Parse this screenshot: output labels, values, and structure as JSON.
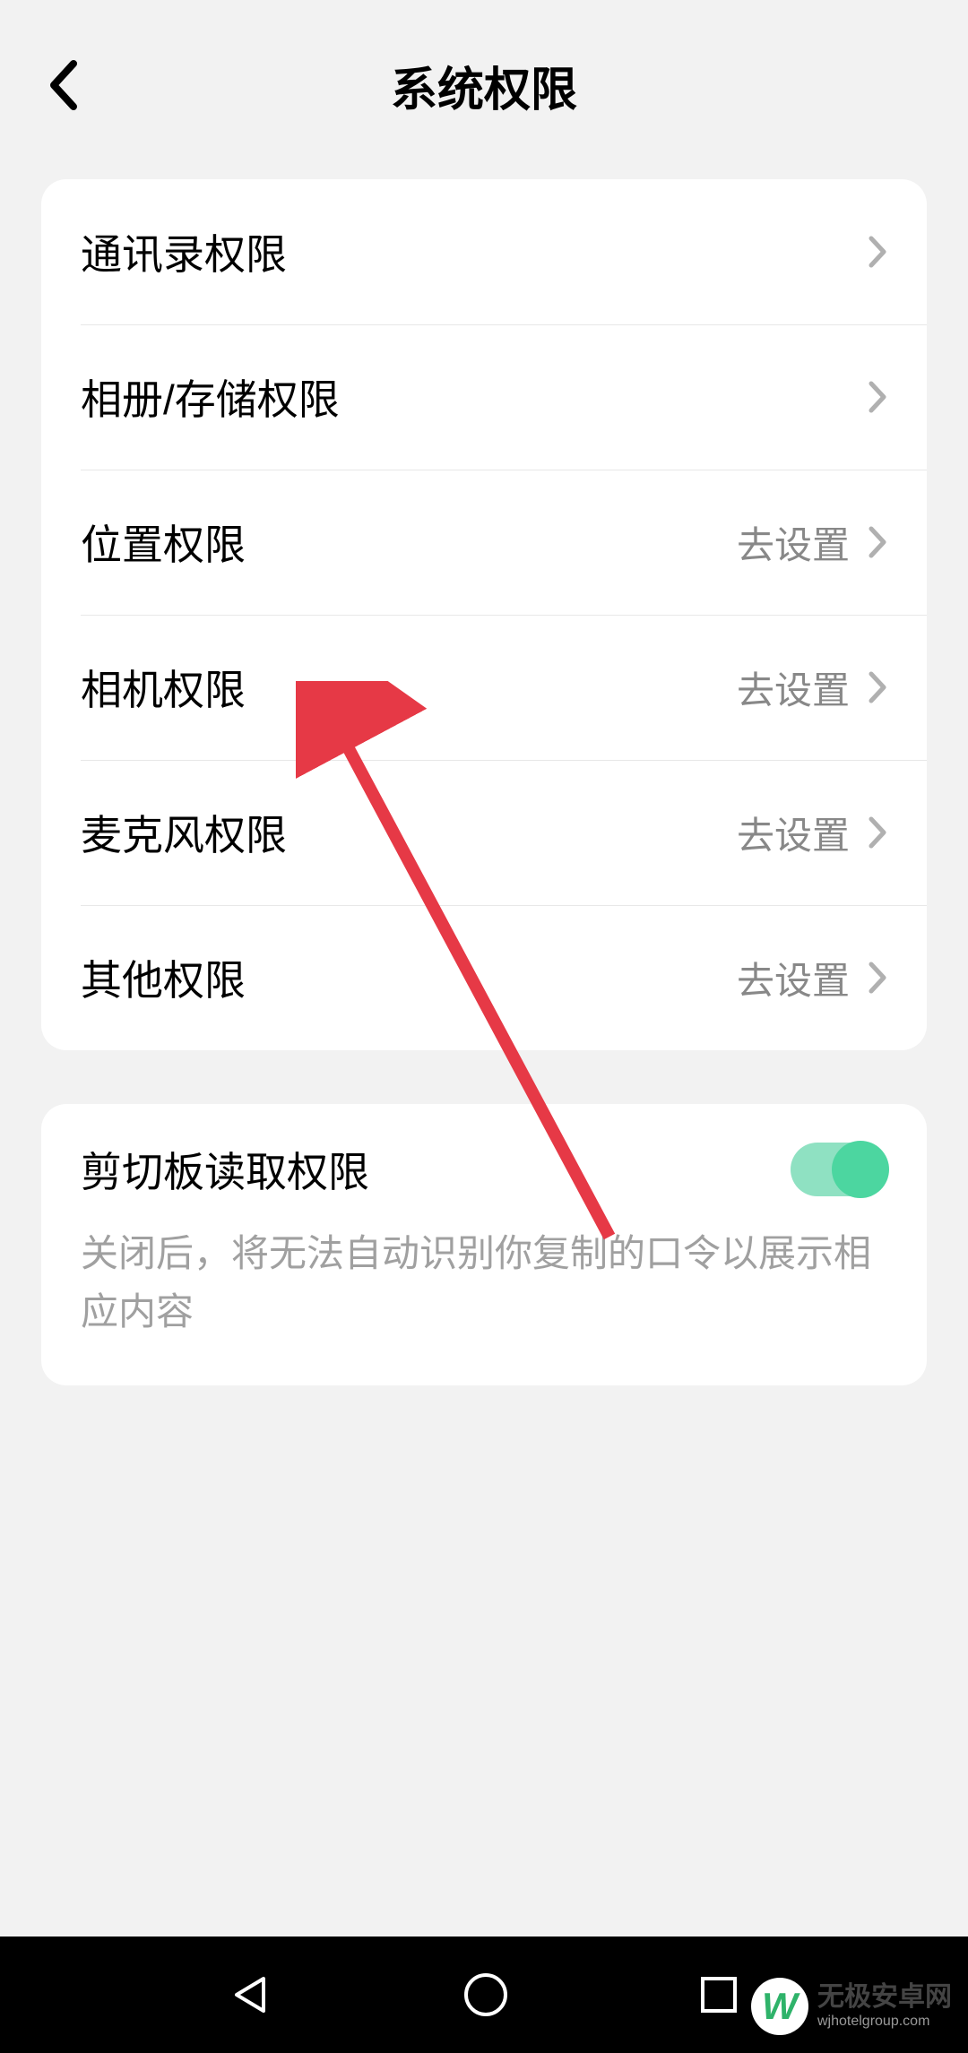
{
  "header": {
    "title": "系统权限"
  },
  "permissions": [
    {
      "label": "通讯录权限",
      "action": ""
    },
    {
      "label": "相册/存储权限",
      "action": ""
    },
    {
      "label": "位置权限",
      "action": "去设置"
    },
    {
      "label": "相机权限",
      "action": "去设置"
    },
    {
      "label": "麦克风权限",
      "action": "去设置"
    },
    {
      "label": "其他权限",
      "action": "去设置"
    }
  ],
  "clipboard": {
    "label": "剪切板读取权限",
    "description": "关闭后，将无法自动识别你复制的口令以展示相应内容",
    "enabled": true
  },
  "watermark": {
    "logo_text": "W",
    "title": "无极安卓网",
    "subtitle": "wjhotelgroup.com"
  },
  "colors": {
    "accent": "#4cd6a0",
    "arrow": "#e63946"
  }
}
